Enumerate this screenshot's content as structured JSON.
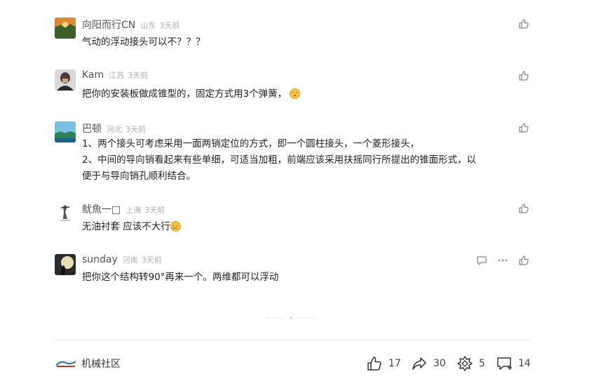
{
  "comments": [
    {
      "user": "向阳而行CN",
      "location": "山东",
      "time": "3天前",
      "text": "气动的浮动接头可以不？？？"
    },
    {
      "user": "Kam",
      "location": "江苏",
      "time": "3天前",
      "text": "把你的安装板做成锥型的，固定方式用3个弹簧，"
    },
    {
      "user": "巴顿",
      "location": "河北",
      "time": "3天前",
      "text_line1": "1、两个接头可考虑采用一面两销定位的方式，即一个圆柱接头，一个菱形接头，",
      "text_line2": "2、中间的导向销看起来有些单细，可适当加粗，前端应该采用扶摇同行所提出的锥面形式，以",
      "text_line3": "便于与导向销孔顺利结合。"
    },
    {
      "user": "鱿魚一□",
      "location": "上海",
      "time": "3天前",
      "text": "无油衬套 应该不大行"
    },
    {
      "user": "sunday",
      "location": "河南",
      "time": "3天前",
      "text": "把你这个结构转90°再来一个。两维都可以浮动"
    }
  ],
  "footer": {
    "community": "机械社区",
    "likes": "17",
    "shares": "30",
    "collects": "5",
    "comments": "14"
  },
  "colors": {
    "accent": "#333333",
    "muted": "#b0b0b0",
    "divider": "#e8e8e8"
  }
}
